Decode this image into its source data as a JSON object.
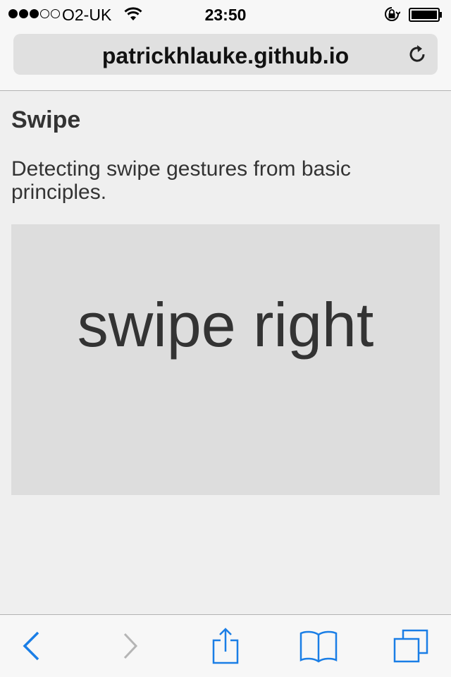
{
  "status_bar": {
    "signal_bars_filled": 3,
    "signal_bars_total": 5,
    "carrier": "O2-UK",
    "time": "23:50",
    "icons": [
      "wifi-icon",
      "rotation-lock-icon",
      "battery-icon"
    ]
  },
  "browser": {
    "url": "patrickhlauke.github.io",
    "reload_icon": "reload-icon"
  },
  "page": {
    "title": "Swipe",
    "description": "Detecting swipe gestures from basic principles.",
    "swipe_label": "swipe right"
  },
  "toolbar": {
    "icons": [
      "back-icon",
      "forward-icon",
      "share-icon",
      "bookmarks-icon",
      "tabs-icon"
    ],
    "accent_color": "#1a7ee6",
    "disabled_color": "#b5b5b5"
  },
  "colors": {
    "background": "#efefef",
    "swipe_area": "#dddddd",
    "text": "#333333"
  }
}
